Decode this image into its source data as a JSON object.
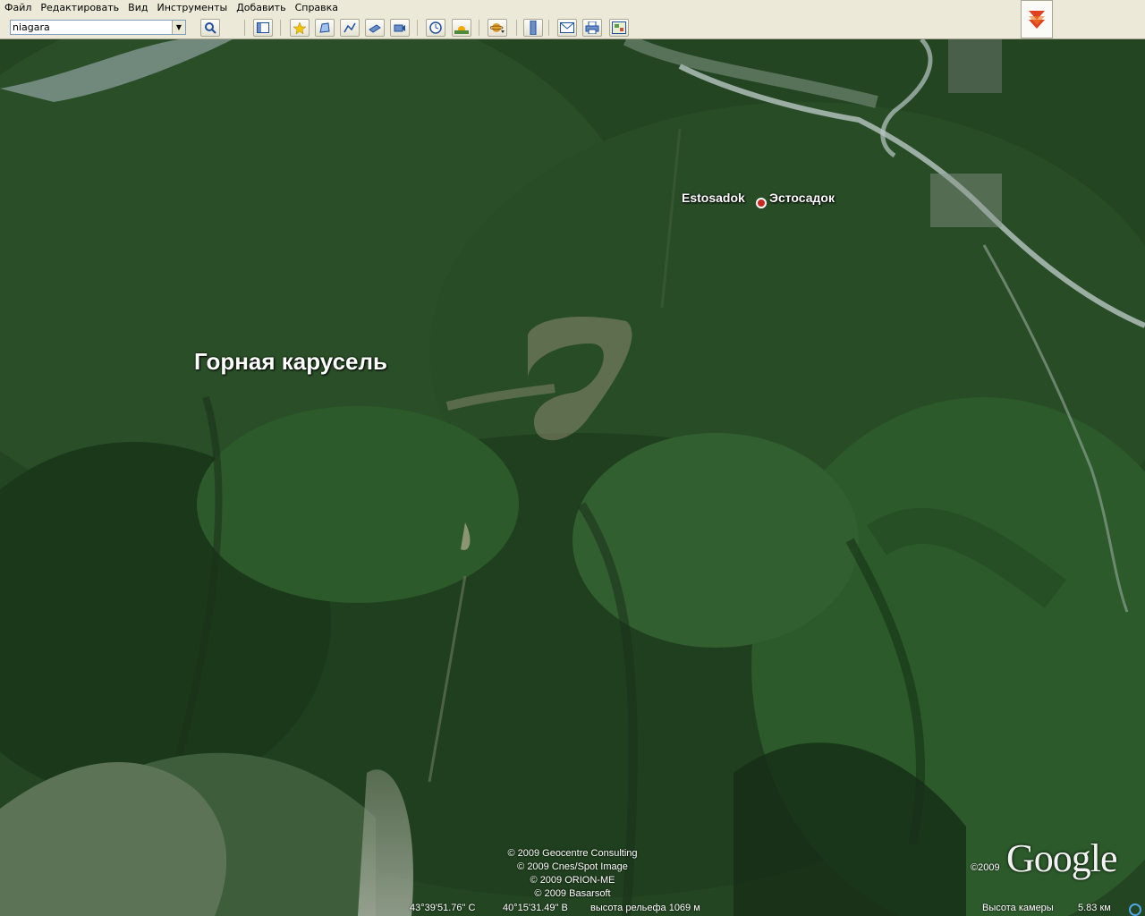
{
  "menu": {
    "items": [
      {
        "label": "Файл"
      },
      {
        "label": "Редактировать"
      },
      {
        "label": "Вид"
      },
      {
        "label": "Инструменты"
      },
      {
        "label": "Добавить"
      },
      {
        "label": "Справка"
      }
    ]
  },
  "toolbar": {
    "search_value": "niagara",
    "buttons": [
      {
        "icon": "search-icon"
      },
      {
        "icon": "sidebar-toggle-icon"
      },
      {
        "icon": "add-placemark-icon"
      },
      {
        "icon": "add-polygon-icon"
      },
      {
        "icon": "add-path-icon"
      },
      {
        "icon": "add-image-overlay-icon"
      },
      {
        "icon": "record-tour-icon"
      },
      {
        "icon": "historical-imagery-icon"
      },
      {
        "icon": "sunlight-icon"
      },
      {
        "icon": "switch-planet-icon"
      },
      {
        "icon": "ruler-icon"
      },
      {
        "icon": "email-icon"
      },
      {
        "icon": "print-icon"
      },
      {
        "icon": "view-in-maps-icon"
      }
    ],
    "collapse_icon": "double-chevron-down-icon"
  },
  "map": {
    "labels": {
      "main_place": "Горная карусель",
      "settlement_en": "Estosadok",
      "settlement_ru": "Эстосадок"
    },
    "credits": [
      "© 2009 Geocentre Consulting",
      "© 2009 Cnes/Spot Image",
      "© 2009 ORION-ME",
      "© 2009 Basarsoft"
    ],
    "logo": "Google",
    "logo_year": "©2009"
  },
  "status": {
    "latitude": "43°39'51.76\" С",
    "longitude": "40°15'31.49\" В",
    "elevation": "высота рельефа 1069 м",
    "camera_label": "Высота камеры",
    "camera_value": "5.83 км"
  },
  "colors": {
    "forest_dark": "#1d3d1d",
    "forest_mid": "#2f5a2a",
    "river": "#b9c6c4",
    "pin": "#c8281e"
  }
}
